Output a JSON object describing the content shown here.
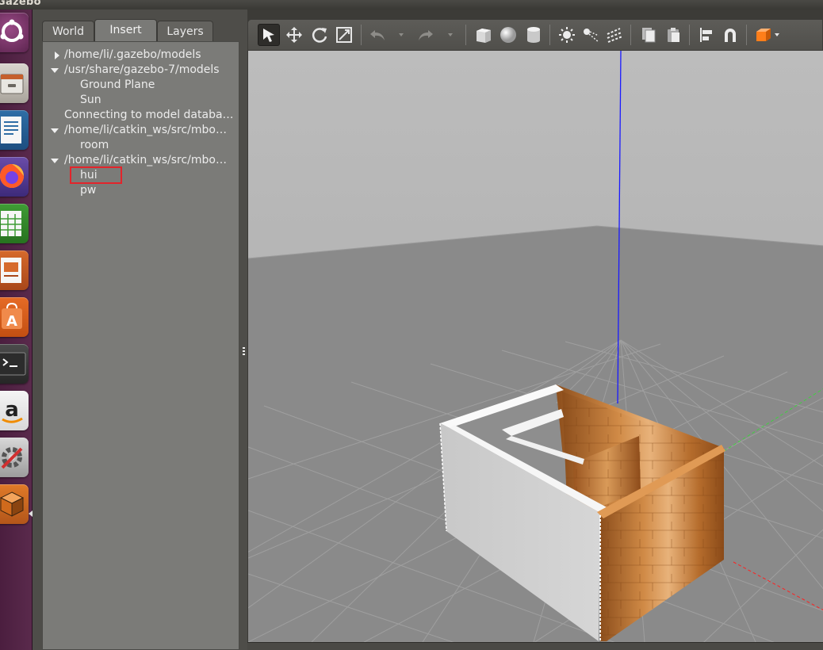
{
  "window": {
    "app_title": "Gazebo"
  },
  "launcher": {
    "items": [
      {
        "name": "dash-home-icon"
      },
      {
        "name": "file-manager-icon"
      },
      {
        "name": "document-writer-icon"
      },
      {
        "name": "firefox-icon"
      },
      {
        "name": "spreadsheet-icon"
      },
      {
        "name": "presentation-icon"
      },
      {
        "name": "software-center-icon"
      },
      {
        "name": "terminal-icon"
      },
      {
        "name": "amazon-icon"
      },
      {
        "name": "system-settings-icon"
      },
      {
        "name": "gazebo-icon"
      }
    ],
    "colors": {
      "bar": "#4b1e3f",
      "accent": "#e95420"
    }
  },
  "tabs": [
    {
      "label": "World"
    },
    {
      "label": "Insert"
    },
    {
      "label": "Layers"
    }
  ],
  "active_tab": "Insert",
  "tree": [
    {
      "label": "/home/li/.gazebo/models",
      "expanded": false
    },
    {
      "label": "/usr/share/gazebo-7/models",
      "expanded": true
    },
    {
      "label": "Ground Plane"
    },
    {
      "label": "Sun"
    },
    {
      "label": "Connecting to model databa…"
    },
    {
      "label": "/home/li/catkin_ws/src/mbo…",
      "expanded": true
    },
    {
      "label": "room"
    },
    {
      "label": "/home/li/catkin_ws/src/mbo…",
      "expanded": true
    },
    {
      "label": "hui",
      "highlighted": true
    },
    {
      "label": "pw"
    }
  ],
  "toolbar": {
    "tools": [
      {
        "name": "select-mode-button",
        "icon": "arrow-cursor-icon",
        "active": true
      },
      {
        "name": "translate-mode-button",
        "icon": "move-arrows-icon"
      },
      {
        "name": "rotate-mode-button",
        "icon": "rotate-icon"
      },
      {
        "name": "scale-mode-button",
        "icon": "scale-icon"
      },
      {
        "name": "undo-button",
        "icon": "undo-icon",
        "disabled": true
      },
      {
        "name": "redo-button",
        "icon": "redo-icon",
        "disabled": true
      },
      {
        "name": "box-shape-button",
        "icon": "cube-icon"
      },
      {
        "name": "sphere-shape-button",
        "icon": "sphere-icon"
      },
      {
        "name": "cylinder-shape-button",
        "icon": "cylinder-icon"
      },
      {
        "name": "point-light-button",
        "icon": "sun-icon"
      },
      {
        "name": "spot-light-button",
        "icon": "spot-light-icon"
      },
      {
        "name": "directional-light-button",
        "icon": "directional-light-icon"
      },
      {
        "name": "copy-button",
        "icon": "copy-icon"
      },
      {
        "name": "paste-button",
        "icon": "paste-icon"
      },
      {
        "name": "align-button",
        "icon": "align-icon"
      },
      {
        "name": "snap-button",
        "icon": "magnet-icon"
      },
      {
        "name": "view-angle-button",
        "icon": "orange-cube-icon"
      }
    ]
  },
  "viewport": {
    "background": "#b4b4b4",
    "ground_color": "#888888",
    "z_axis_color": "#1a1aff",
    "x_axis_color": "#ff2020",
    "y_axis_color": "#20ff20",
    "model": {
      "wall_white": "#f2f2f2",
      "wood": "#b8702e"
    }
  }
}
